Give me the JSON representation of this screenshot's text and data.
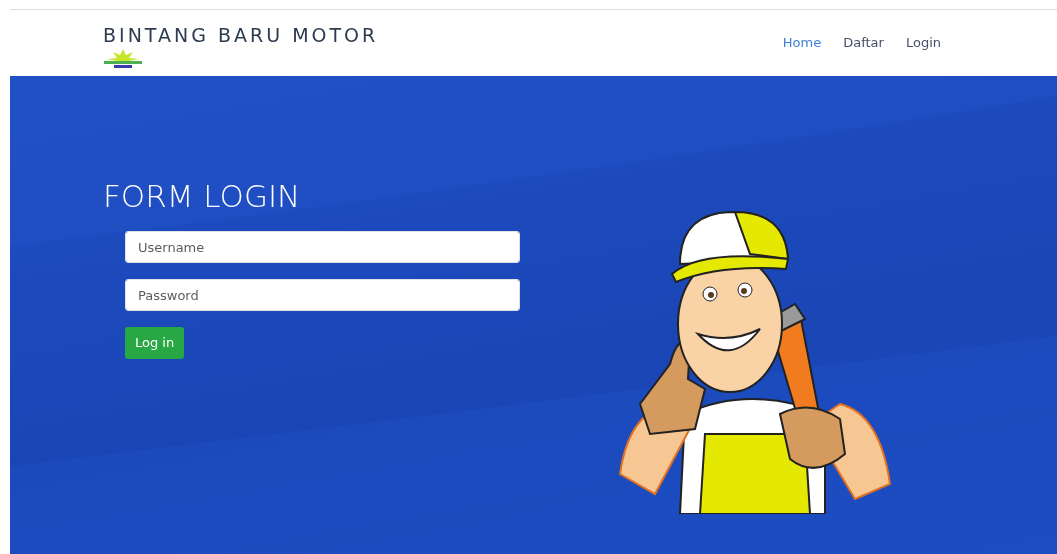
{
  "navbar": {
    "brand": "BINTANG BARU MOTOR",
    "links": [
      {
        "label": "Home",
        "selected": true
      },
      {
        "label": "Daftar",
        "selected": false
      },
      {
        "label": "Login",
        "selected": false
      }
    ]
  },
  "form": {
    "title": "FORM LOGIN",
    "fields": [
      {
        "placeholder": "Username"
      },
      {
        "placeholder": "Password"
      }
    ],
    "button": "Log in"
  }
}
